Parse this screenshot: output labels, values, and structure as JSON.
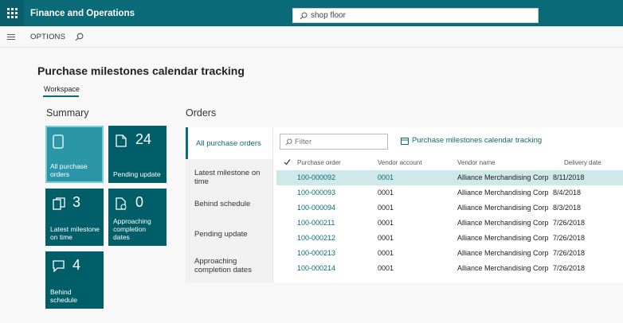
{
  "app": {
    "title": "Finance and Operations"
  },
  "search": {
    "value": "shop floor"
  },
  "actionbar": {
    "options_label": "OPTIONS"
  },
  "page": {
    "title": "Purchase milestones calendar tracking",
    "tab": "Workspace"
  },
  "summary": {
    "heading": "Summary",
    "tiles": [
      {
        "label": "All purchase orders",
        "count": "",
        "icon": "document-icon"
      },
      {
        "label": "Pending update",
        "count": "24",
        "icon": "document-icon"
      },
      {
        "label": "Latest milestone on time",
        "count": "3",
        "icon": "documents-icon"
      },
      {
        "label": "Approaching completion dates",
        "count": "0",
        "icon": "document-clock-icon"
      },
      {
        "label": "Behind schedule",
        "count": "4",
        "icon": "chat-icon"
      }
    ]
  },
  "orders": {
    "heading": "Orders",
    "nav": [
      "All purchase orders",
      "Latest milestone on time",
      "Behind schedule",
      "Pending update",
      "Approaching completion dates"
    ],
    "filter_placeholder": "Filter",
    "calendar_link": "Purchase milestones calendar tracking",
    "columns": [
      "Purchase order",
      "Vendor account",
      "Vendor name",
      "Delivery date"
    ],
    "rows": [
      [
        "100-000092",
        "0001",
        "Alliance Merchandising Corp",
        "8/11/2018"
      ],
      [
        "100-000093",
        "0001",
        "Alliance Merchandising Corp",
        "8/4/2018"
      ],
      [
        "100-000094",
        "0001",
        "Alliance Merchandising Corp",
        "8/3/2018"
      ],
      [
        "100-000211",
        "0001",
        "Alliance Merchandising Corp",
        "7/26/2018"
      ],
      [
        "100-000212",
        "0001",
        "Alliance Merchandising Corp",
        "7/26/2018"
      ],
      [
        "100-000213",
        "0001",
        "Alliance Merchandising Corp",
        "7/26/2018"
      ],
      [
        "100-000214",
        "0001",
        "Alliance Merchandising Corp",
        "7/26/2018"
      ]
    ]
  },
  "colors": {
    "brand": "#0b6a78",
    "tile": "#005e68",
    "tile_selected": "#2b96a8",
    "row_selected": "#cfe8ea"
  }
}
